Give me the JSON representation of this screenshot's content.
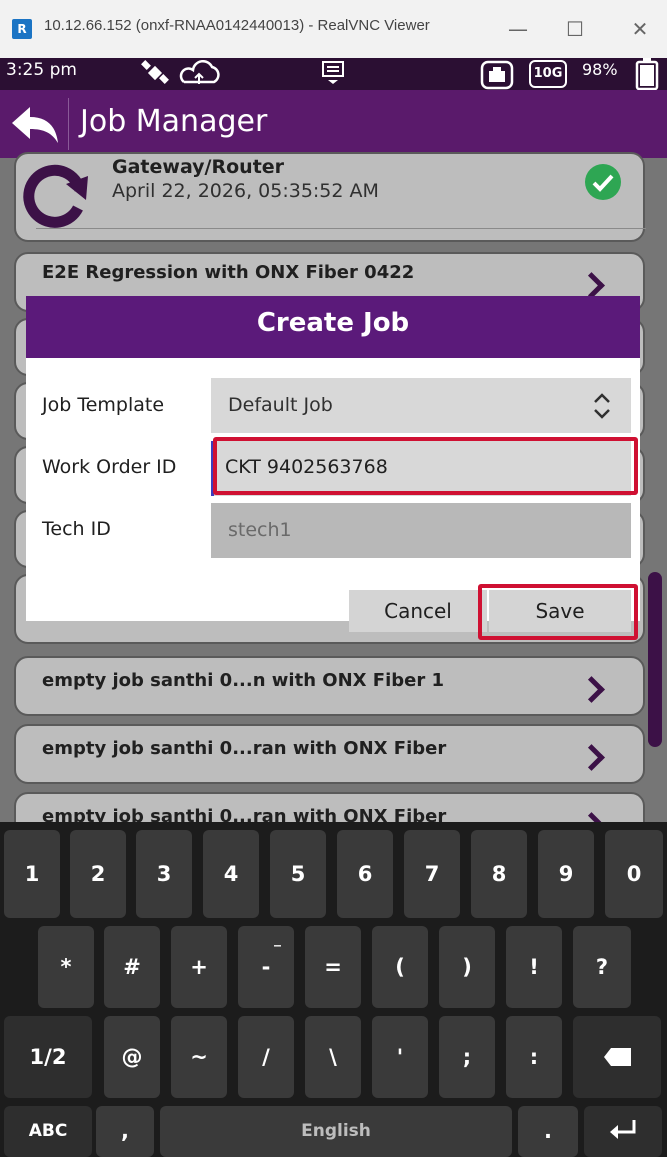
{
  "window": {
    "logo_text": "R",
    "title": "10.12.66.152 (onxf-RNAA0142440013) - RealVNC Viewer",
    "minimize": "—",
    "maximize": "☐",
    "close": "✕"
  },
  "status_bar": {
    "time": "3:25 pm",
    "battery": "98%",
    "speed_badge": "10G"
  },
  "header": {
    "title": "Job Manager"
  },
  "jobs": {
    "first": {
      "name": "Gateway/Router",
      "date": "April 22, 2026, 05:35:52 AM"
    },
    "second": {
      "name": "E2E Regression with ONX Fiber 0422"
    },
    "lower": [
      "empty job santhi 0...n with ONX Fiber 1",
      "empty job santhi 0...ran with ONX Fiber",
      "empty job santhi 0...ran with ONX Fiber"
    ]
  },
  "dialog": {
    "title": "Create Job",
    "template_label": "Job Template",
    "template_value": "Default Job",
    "work_order_label": "Work Order ID",
    "work_order_value": "CKT 9402563768",
    "tech_label": "Tech ID",
    "tech_value": "stech1",
    "cancel": "Cancel",
    "save": "Save"
  },
  "colors": {
    "header": "#5a1a6b",
    "dialog_header": "#5b1a7a",
    "highlight": "#cf1032",
    "ok_green": "#2ea653"
  },
  "keyboard": {
    "row1": [
      "1",
      "2",
      "3",
      "4",
      "5",
      "6",
      "7",
      "8",
      "9",
      "0"
    ],
    "row2": [
      "*",
      "#",
      "+",
      "-",
      "=",
      "(",
      ")",
      "!",
      "?"
    ],
    "row2_hint": "_",
    "row3": [
      "1/2",
      "@",
      "~",
      "/",
      "\\",
      "'",
      ";",
      ":"
    ],
    "row4": {
      "abc": "ABC",
      "comma": ",",
      "space": "English",
      "period": "."
    }
  }
}
